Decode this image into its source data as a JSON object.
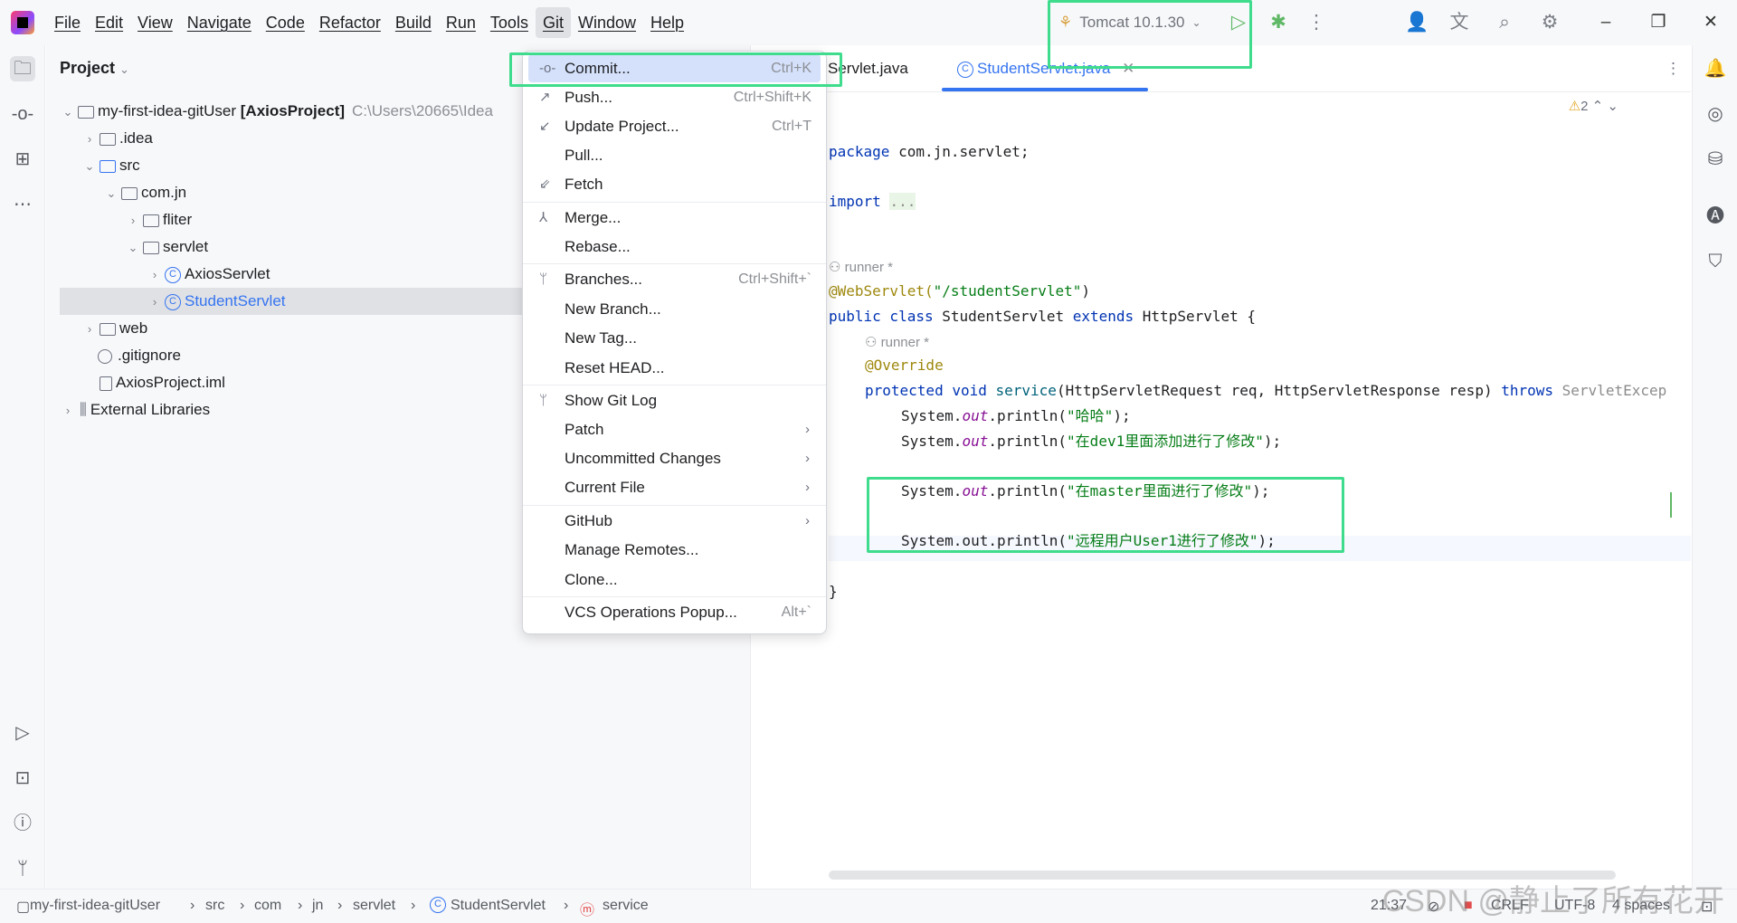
{
  "menubar": [
    "File",
    "Edit",
    "View",
    "Navigate",
    "Code",
    "Refactor",
    "Build",
    "Run",
    "Tools",
    "Git",
    "Window",
    "Help"
  ],
  "toolbar": {
    "run_config": "Tomcat 10.1.30"
  },
  "project": {
    "title": "Project",
    "root_name": "my-first-idea-gitUser",
    "root_module": "[AxiosProject]",
    "root_path": "C:\\Users\\20665\\Idea",
    "items": {
      "idea": ".idea",
      "src": "src",
      "comjn": "com.jn",
      "fliter": "fliter",
      "servlet": "servlet",
      "axios": "AxiosServlet",
      "student": "StudentServlet",
      "web": "web",
      "gitignore": ".gitignore",
      "iml": "AxiosProject.iml",
      "ext": "External Libraries"
    }
  },
  "tabs": {
    "tab1": "Servlet.java",
    "tab2": "StudentServlet.java"
  },
  "editor": {
    "warnings": "2",
    "l1a": "package",
    "l1b": " com.jn.servlet;",
    "l2a": "import",
    "l2b": "...",
    "hint1": "runner *",
    "l3a": "@WebServlet(",
    "l3b": "\"/studentServlet\"",
    "l3c": ")",
    "l4a": "public class",
    "l4b": " StudentServlet ",
    "l4c": "extends",
    "l4d": " HttpServlet {",
    "hint2": "runner *",
    "l5": "@Override",
    "l6a": "protected void ",
    "l6b": "service",
    "l6c": "(HttpServletRequest req, HttpServletResponse resp) ",
    "l6d": "throws",
    "l6e": " ServletExcep",
    "l7a": "System.",
    "l7b": "out",
    "l7c": ".println(",
    "l7d": "\"哈哈\"",
    "l7e": ");",
    "l8d": "\"在dev1里面添加进行了修改\"",
    "l9d": "\"在master里面进行了修改\"",
    "l10a": "System.out.println(",
    "l10d": "\"远程用户User1进行了修改\"",
    "l11": "}"
  },
  "gitmenu": {
    "commit": "Commit...",
    "commit_sc": "Ctrl+K",
    "push": "Push...",
    "push_sc": "Ctrl+Shift+K",
    "update": "Update Project...",
    "update_sc": "Ctrl+T",
    "pull": "Pull...",
    "fetch": "Fetch",
    "merge": "Merge...",
    "rebase": "Rebase...",
    "branches": "Branches...",
    "branches_sc": "Ctrl+Shift+`",
    "newbranch": "New Branch...",
    "newtag": "New Tag...",
    "reset": "Reset HEAD...",
    "showlog": "Show Git Log",
    "patch": "Patch",
    "uncommitted": "Uncommitted Changes",
    "currentfile": "Current File",
    "github": "GitHub",
    "remotes": "Manage Remotes...",
    "clone": "Clone...",
    "vcs": "VCS Operations Popup...",
    "vcs_sc": "Alt+`"
  },
  "status": {
    "c1": "my-first-idea-gitUser",
    "c2": "src",
    "c3": "com",
    "c4": "jn",
    "c5": "servlet",
    "c6": "StudentServlet",
    "c7": "service",
    "pos": "21:37",
    "lineend": "CRLF",
    "enc": "UTF-8",
    "indent": "4 spaces"
  },
  "watermark": "CSDN @静止了所有花开",
  "colors": {
    "accent": "#3574f0",
    "highlight_box": "#3edc8c",
    "menu_selection": "#d5e1fb"
  }
}
